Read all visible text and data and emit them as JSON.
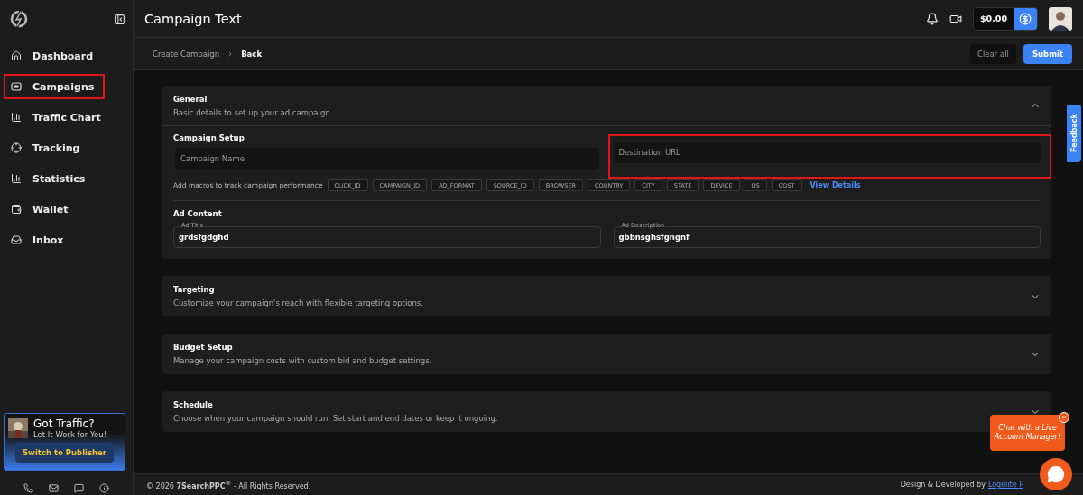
{
  "page_title": "Campaign Text",
  "balance": "$0.00",
  "nav": [
    {
      "label": "Dashboard",
      "highlighted": false
    },
    {
      "label": "Campaigns",
      "highlighted": true
    },
    {
      "label": "Traffic Chart",
      "highlighted": false
    },
    {
      "label": "Tracking",
      "highlighted": false
    },
    {
      "label": "Statistics",
      "highlighted": false
    },
    {
      "label": "Wallet",
      "highlighted": false
    },
    {
      "label": "Inbox",
      "highlighted": false
    }
  ],
  "promo": {
    "title": "Got Traffic?",
    "subtitle": "Let It Work for You!",
    "button": "Switch to Publisher"
  },
  "breadcrumb": [
    "Create Campaign",
    "Back"
  ],
  "actions": {
    "clear": "Clear all",
    "submit": "Submit"
  },
  "sections": [
    {
      "title": "General",
      "subtitle": "Basic details to set up your ad campaign.",
      "expanded": true
    },
    {
      "title": "Targeting",
      "subtitle": "Customize your campaign's reach with flexible targeting options.",
      "expanded": false
    },
    {
      "title": "Budget Setup",
      "subtitle": "Manage your campaign costs with custom bid and budget settings.",
      "expanded": false
    },
    {
      "title": "Schedule",
      "subtitle": "Choose when your campaign should run. Set start and end dates or keep it ongoing.",
      "expanded": false
    }
  ],
  "general": {
    "setup_title": "Campaign Setup",
    "fields": [
      {
        "placeholder": "Campaign Name",
        "highlighted": false
      },
      {
        "placeholder": "Destination URL",
        "highlighted": true
      }
    ],
    "macros_label": "Add macros to track campaign performance",
    "macros": [
      "CLICK_ID",
      "CAMPAIGN_ID",
      "AD_FORMAT",
      "SOURCE_ID",
      "BROWSER",
      "COUNTRY",
      "CITY",
      "STATE",
      "DEVICE",
      "OS",
      "COST"
    ],
    "view_details": "View Details",
    "ad_content_title": "Ad Content",
    "ad_fields": [
      {
        "label": "Ad Title",
        "value": "grdsfgdghd"
      },
      {
        "label": "Ad Description",
        "value": "gbbnsghsfgngnf"
      }
    ]
  },
  "feedback": "Feedback",
  "chat": {
    "message": "Chat with a Live Account Manager!",
    "close": "×"
  },
  "footer": {
    "copyright": "© 2026 **7SearchPPC**$^{®}$ - All Rights Reserved.",
    "credit": "Design & Developed by",
    "link": "Logelite P"
  }
}
